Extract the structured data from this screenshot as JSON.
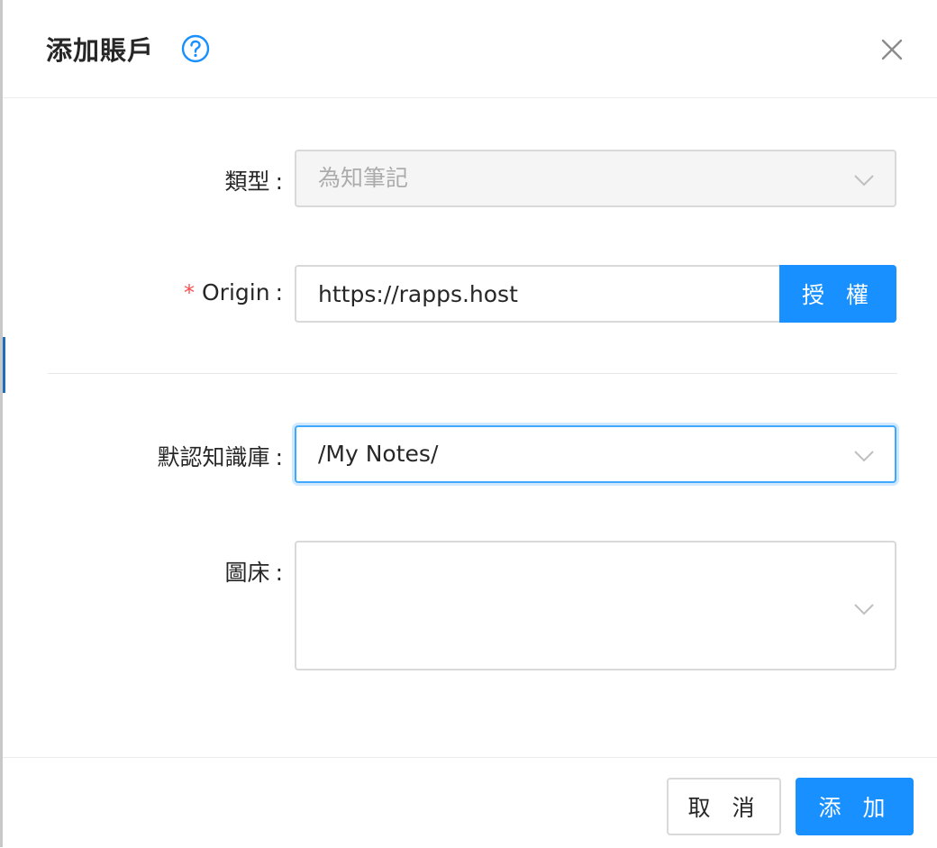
{
  "dialog": {
    "title": "添加賬戶"
  },
  "form": {
    "type": {
      "label": "類型",
      "value": "為知筆記",
      "disabled": true
    },
    "origin": {
      "label": "Origin",
      "required_mark": "*",
      "value": "https://rapps.host",
      "button_label": "授 權"
    },
    "knowledge_base": {
      "label": "默認知識庫",
      "value": "/My Notes/"
    },
    "image_host": {
      "label": "圖床",
      "value": ""
    },
    "colon": ":"
  },
  "footer": {
    "cancel_label": "取 消",
    "submit_label": "添 加"
  },
  "colors": {
    "primary": "#1890ff",
    "required": "#ff4d4f",
    "help_icon": "#1890ff"
  },
  "icons": {
    "help": "question-circle-icon",
    "close": "close-icon",
    "dropdown": "chevron-down-icon"
  }
}
